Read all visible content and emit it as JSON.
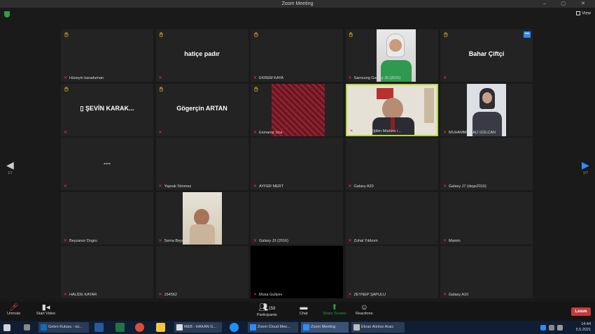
{
  "window": {
    "title": "Zoom Meeting",
    "controls": "–  ▢  ✕"
  },
  "view_label": "View",
  "tiles": [
    {
      "name": "Hüseyin karaduman",
      "hand": true
    },
    {
      "name": "",
      "display": "hatiçe padır",
      "hand": true
    },
    {
      "name": "EKREM KAYA",
      "hand": true
    },
    {
      "name": "Samsung Galaxy J5 (2016)",
      "hand": true,
      "video": "headscarf"
    },
    {
      "name": "",
      "display": "Bahar Çiftçi",
      "hand": true,
      "badge": true
    },
    {
      "name": "",
      "display": "▯ ŞEVİN KARAK...",
      "hand": true
    },
    {
      "name": "",
      "display": "Gögerçin ARTAN",
      "hand": true
    },
    {
      "name": "Esmanur Uca",
      "hand": true,
      "video": "pattern"
    },
    {
      "name": "İğdır Mili Eğitim Müdürü /...",
      "hand": false,
      "video": "office",
      "active": true
    },
    {
      "name": "MUHAMMED ALİ GÜLCAN",
      "hand": false,
      "video": "student"
    },
    {
      "name": "",
      "display": "....",
      "hand": false
    },
    {
      "name": "Yaprak Sönmez",
      "hand": false
    },
    {
      "name": "AYFER MERT",
      "hand": false
    },
    {
      "name": "Galaxy A20",
      "hand": false
    },
    {
      "name": "Galaxy J7 (degs2016)",
      "hand": false
    },
    {
      "name": "Beyzanur Dogru",
      "hand": false
    },
    {
      "name": "Sema Beyazıt",
      "hand": false,
      "video": "child"
    },
    {
      "name": "Galaxy J3 (2016)",
      "hand": false
    },
    {
      "name": "Zuhal Yıldırım",
      "hand": false
    },
    {
      "name": "Mamin",
      "hand": false
    },
    {
      "name": "HALİDE KAYAR",
      "hand": false
    },
    {
      "name": "154562",
      "hand": false
    },
    {
      "name": "Musa Guliyev",
      "hand": false,
      "video": "black"
    },
    {
      "name": "ZEYNEP ŞAPULU",
      "hand": false
    },
    {
      "name": "Galaxy A10",
      "hand": false
    }
  ],
  "nav": {
    "left": "1/7",
    "right": "1/7"
  },
  "controls": {
    "unmute": "Unmute",
    "video": "Start Video",
    "participants": "Participants",
    "participants_count": "158",
    "chat": "Chat",
    "share": "Share Screen",
    "reactions": "Reactions",
    "leave": "Leave"
  },
  "taskbar": {
    "items": [
      "Gelen Kutusu - sü...",
      "",
      "",
      "",
      "",
      "MEB - HAKAN G...",
      "",
      "Zoom Cloud Mee...",
      "Zoom Meeting",
      "Ekran Alıntısı Aracı"
    ],
    "time": "14:44",
    "date": "5.5.2021"
  },
  "colors": {
    "hand": "#f2c12e",
    "active_border": "#b5d93b",
    "mic_off": "#e0413c",
    "leave": "#c63a3a"
  }
}
